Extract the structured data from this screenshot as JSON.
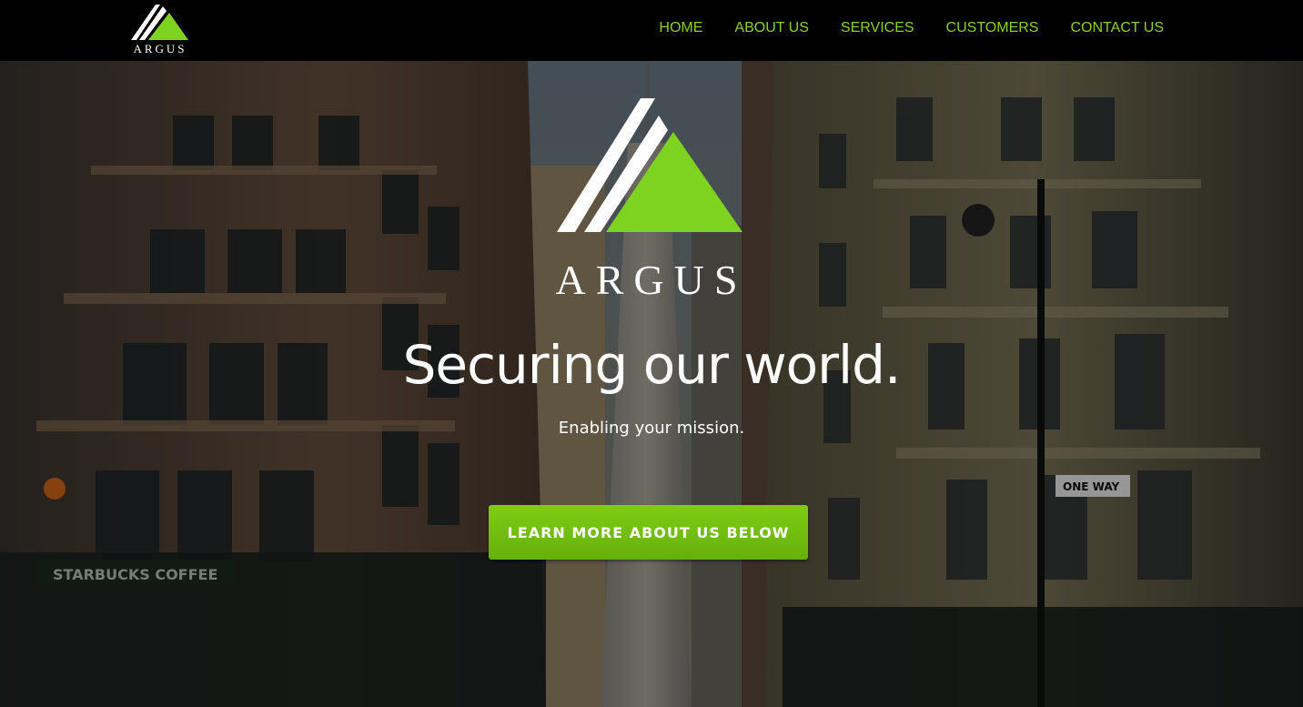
{
  "brand": {
    "name": "ARGUS",
    "accent_color": "#7ed321",
    "logo_icon": "argus-triangle-logo"
  },
  "nav": {
    "items": [
      {
        "label": "HOME"
      },
      {
        "label": "ABOUT US"
      },
      {
        "label": "SERVICES"
      },
      {
        "label": "CUSTOMERS"
      },
      {
        "label": "CONTACT US"
      }
    ],
    "link_color": "#8ed21c"
  },
  "hero": {
    "logo_text": "ARGUS",
    "headline": "Securing our world.",
    "subheadline": "Enabling your mission.",
    "cta_label": "LEARN MORE ABOUT US BELOW",
    "cta_color": "#76c00f",
    "background": "city-street-buildings-photo",
    "storefront_sign": "STARBUCKS COFFEE",
    "street_sign": "ONE WAY"
  }
}
